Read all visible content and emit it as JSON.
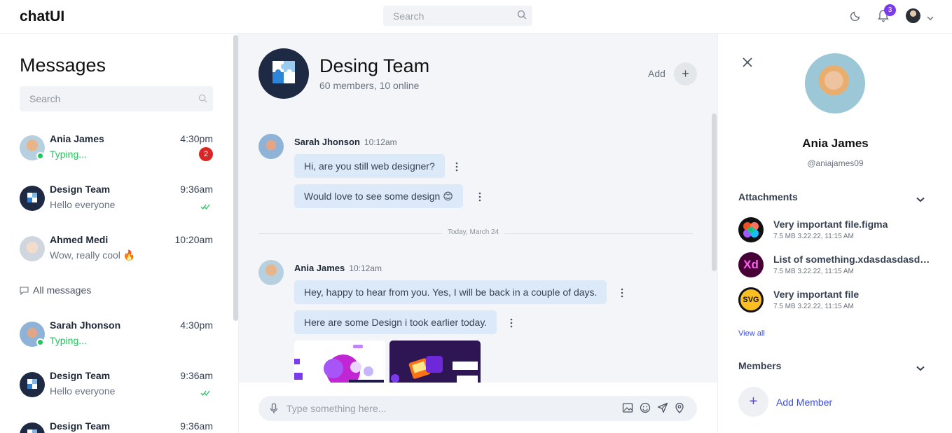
{
  "app": {
    "title": "chatUI"
  },
  "topbar": {
    "search_placeholder": "Search",
    "notification_count": "3"
  },
  "sidebar": {
    "title": "Messages",
    "search_placeholder": "Search",
    "all_messages_label": "All messages",
    "conversations": [
      {
        "name": "Ania James",
        "time": "4:30pm",
        "message": "Typing...",
        "unread": "2"
      },
      {
        "name": "Design Team",
        "time": "9:36am",
        "message": "Hello everyone"
      },
      {
        "name": "Ahmed Medi",
        "time": "10:20am",
        "message": "Wow, really cool 🔥"
      },
      {
        "name": "Sarah Jhonson",
        "time": "4:30pm",
        "message": "Typing..."
      },
      {
        "name": "Design Team",
        "time": "9:36am",
        "message": "Hello everyone"
      },
      {
        "name": "Design Team",
        "time": "9:36am",
        "message": ""
      }
    ]
  },
  "chat": {
    "group_name": "Desing Team",
    "group_status": "60 members, 10 online",
    "add_label": "Add",
    "date_divider": "Today, March 24",
    "messages": [
      {
        "sender": "Sarah Jhonson",
        "time": "10:12am",
        "bubbles": [
          "Hi, are you still web designer?",
          "Would love to see some design 😊"
        ]
      },
      {
        "sender": "Ania James",
        "time": "10:12am",
        "bubbles": [
          "Hey, happy to hear from you. Yes, I will be back in a couple of days.",
          "Here are some Design i took earlier today."
        ]
      }
    ],
    "composer_placeholder": "Type something here..."
  },
  "profile": {
    "name": "Ania James",
    "handle": "@aniajames09",
    "attachments_title": "Attachments",
    "attachments": [
      {
        "name": "Very important file.figma",
        "meta": "7.5 MB 3.22.22, 11:15 AM",
        "icon": "figma-icon"
      },
      {
        "name": "List of something.xdasdasdasdasdas",
        "meta": "7.5 MB 3.22.22, 11:15 AM",
        "icon": "xd-icon",
        "icon_text": "Xd"
      },
      {
        "name": "Very important file",
        "meta": "7.5 MB 3.22.22, 11:15 AM",
        "icon": "svg-icon",
        "icon_text": "SVG"
      }
    ],
    "view_all_label": "View all",
    "members_title": "Members",
    "add_member_label": "Add Member"
  },
  "colors": {
    "accent": "#3b4de0",
    "bubble": "#dbe9f8",
    "online": "#22c55e",
    "badge": "#dc2626",
    "notification": "#7c3aed"
  }
}
